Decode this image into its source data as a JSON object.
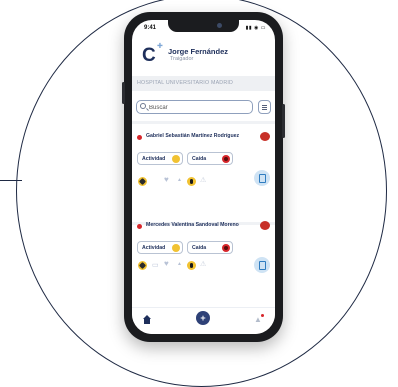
{
  "status_bar": {
    "time": "9:41",
    "icons_text": "▮▮ ◉ ▭"
  },
  "header": {
    "logo_letter": "C",
    "logo_mark": "✚",
    "user_name": "Jorge Fernández",
    "user_role": "Traigador"
  },
  "hospital": {
    "name": "HOSPITAL UNIVERSITARIO MADRID"
  },
  "search": {
    "placeholder": "Buscar"
  },
  "patients": [
    {
      "name": "Gabriel Sebastián Martínez Rodríguez",
      "status_color": "#d7262b",
      "chips": [
        {
          "label": "Actividad"
        },
        {
          "label": "Caída"
        }
      ]
    },
    {
      "name": "Mercedes Valentina Sandoval Moreno",
      "status_color": "#d7262b",
      "chips": [
        {
          "label": "Actividad"
        },
        {
          "label": "Caída"
        }
      ]
    }
  ],
  "tabbar": {
    "items": [
      {
        "icon": "home-icon"
      },
      {
        "icon": "add-icon"
      },
      {
        "icon": "notifications-icon"
      }
    ]
  },
  "colors": {
    "brand": "#1e2f5b",
    "alert": "#d7262b",
    "warning": "#f1c232",
    "accent": "#cfe3f4"
  }
}
